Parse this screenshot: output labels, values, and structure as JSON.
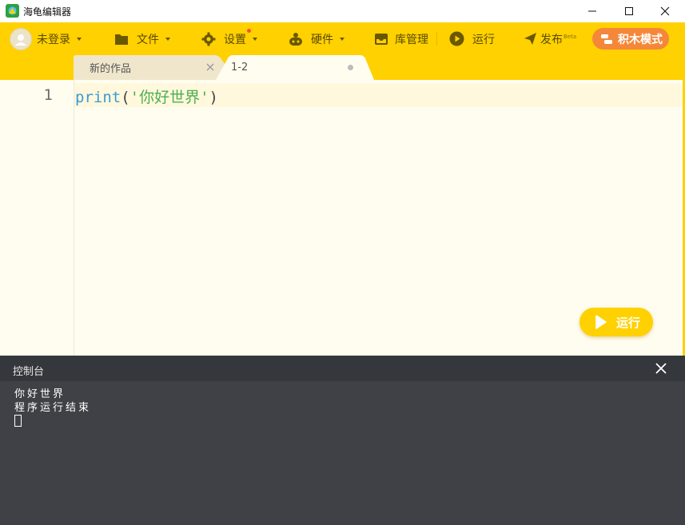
{
  "window": {
    "title": "海龟编辑器",
    "controls": {
      "minimize": "minimize-icon",
      "maximize": "maximize-icon",
      "close": "close-icon"
    }
  },
  "toolbar": {
    "login_label": "未登录",
    "file_label": "文件",
    "settings_label": "设置",
    "hardware_label": "硬件",
    "library_label": "库管理",
    "run_label": "运行",
    "publish_label": "发布",
    "publish_badge": "Beta",
    "block_mode_label": "积木模式"
  },
  "tabs": [
    {
      "label": "新的作品",
      "active": false
    },
    {
      "label": "1-2",
      "active": true,
      "unsaved": true
    }
  ],
  "editor": {
    "line_numbers": [
      "1"
    ],
    "code": {
      "keyword": "print",
      "open": "(",
      "string": "'你好世界'",
      "close": ")"
    },
    "run_button_label": "运行"
  },
  "console": {
    "title": "控制台",
    "lines": [
      "你好世界",
      "程序运行结束"
    ]
  },
  "colors": {
    "toolbar": "#ffd100",
    "block_mode": "#f5873a",
    "editor_bg": "#fffdf0",
    "console_bg": "#3f4146",
    "keyword": "#3a9ad9",
    "string": "#4caf50"
  }
}
